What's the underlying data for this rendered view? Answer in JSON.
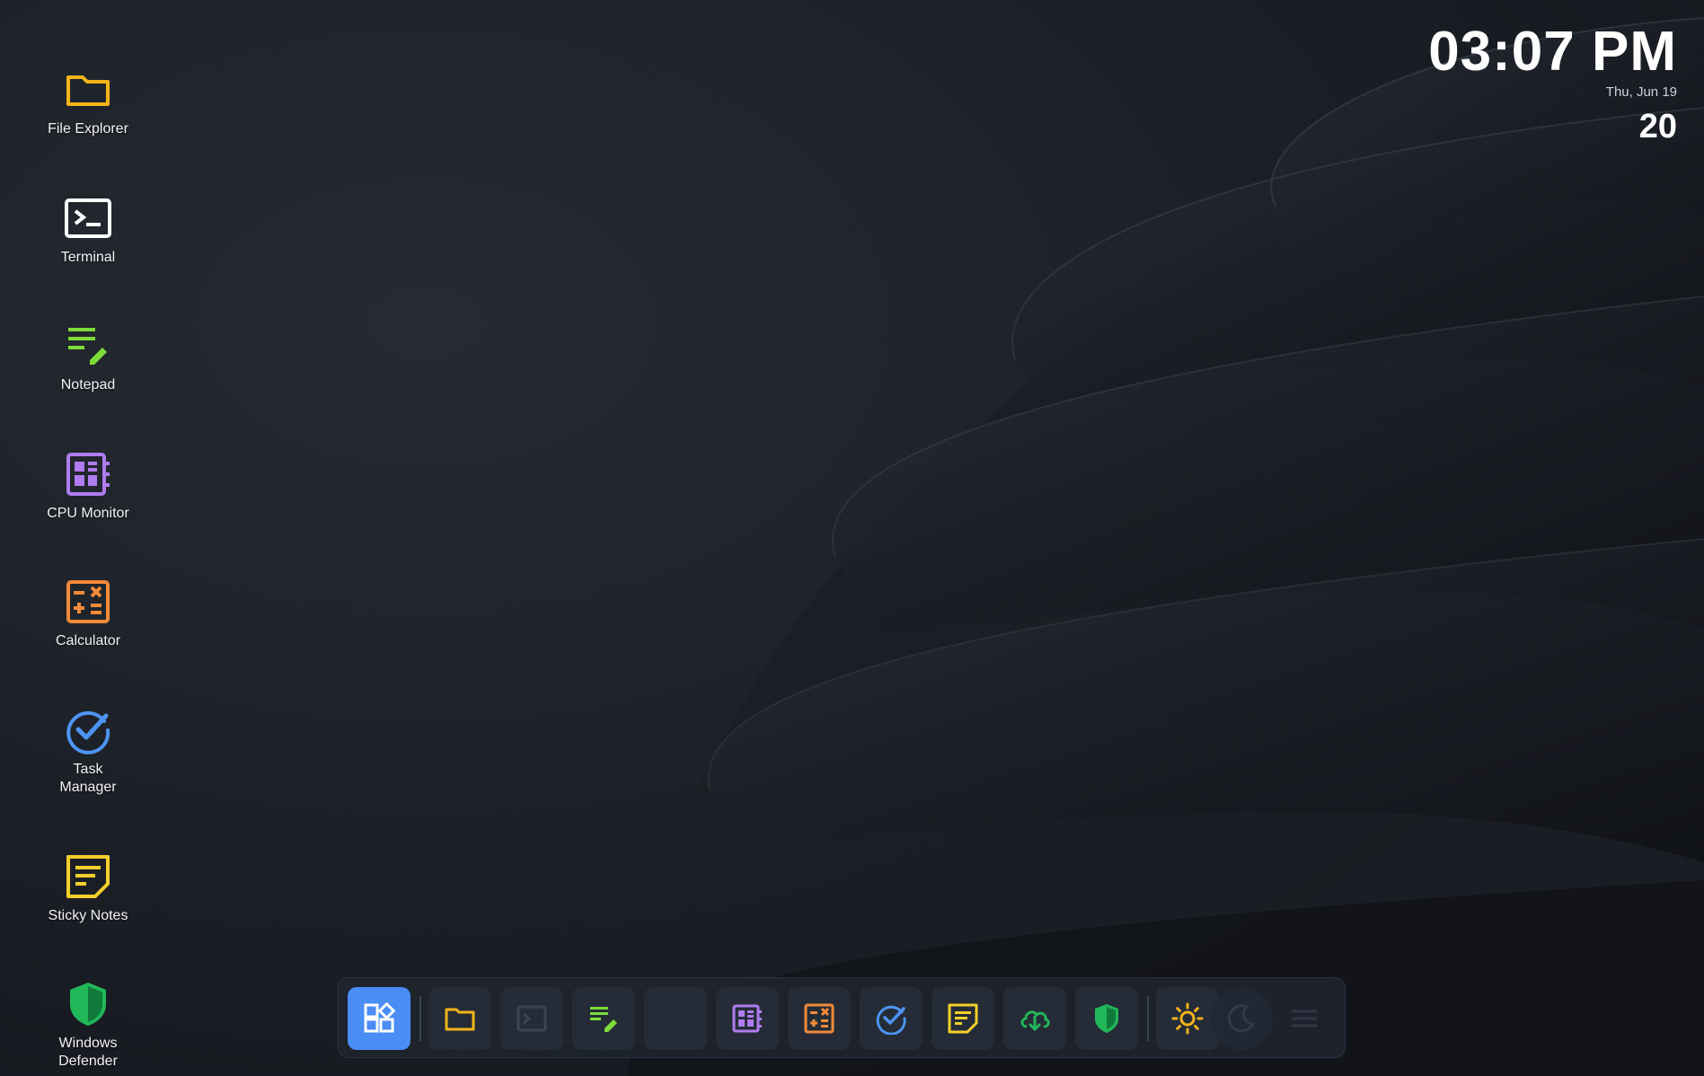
{
  "desktop": {
    "icons": [
      {
        "label": "File Explorer",
        "icon": "folder-icon",
        "color": "#f2b418"
      },
      {
        "label": "Terminal",
        "icon": "terminal-icon",
        "color": "#ffffff"
      },
      {
        "label": "Notepad",
        "icon": "notepad-icon",
        "color": "#7ddc3a"
      },
      {
        "label": "CPU Monitor",
        "icon": "cpu-monitor-icon",
        "color": "#b07cf0"
      },
      {
        "label": "Calculator",
        "icon": "calculator-icon",
        "color": "#f28a3a"
      },
      {
        "label": "Task Manager",
        "icon": "task-check-icon",
        "color": "#4d94f5"
      },
      {
        "label": "Sticky Notes",
        "icon": "sticky-note-icon",
        "color": "#f5cf2a"
      },
      {
        "label": "Windows Defender",
        "icon": "shield-icon",
        "color": "#21b85a"
      }
    ]
  },
  "clock": {
    "time": "03:07 PM",
    "date": "Thu, Jun 19",
    "day": "20"
  },
  "taskbar": {
    "accent": "#4a8df5",
    "items": [
      {
        "name": "start",
        "icon": "apps-grid-icon"
      },
      {
        "name": "file-explorer",
        "icon": "folder-icon"
      },
      {
        "name": "terminal",
        "icon": "terminal-icon"
      },
      {
        "name": "notepad",
        "icon": "notepad-icon"
      },
      {
        "name": "empty-slot",
        "icon": ""
      },
      {
        "name": "cpu-monitor",
        "icon": "cpu-monitor-icon"
      },
      {
        "name": "calculator",
        "icon": "calculator-icon"
      },
      {
        "name": "task-manager",
        "icon": "task-check-icon"
      },
      {
        "name": "sticky-notes",
        "icon": "sticky-note-icon"
      },
      {
        "name": "cloud-download",
        "icon": "cloud-download-icon"
      },
      {
        "name": "windows-defender",
        "icon": "shield-icon"
      },
      {
        "name": "light-mode",
        "icon": "sun-icon"
      },
      {
        "name": "dark-mode",
        "icon": "moon-icon"
      },
      {
        "name": "menu",
        "icon": "menu-icon"
      }
    ]
  }
}
